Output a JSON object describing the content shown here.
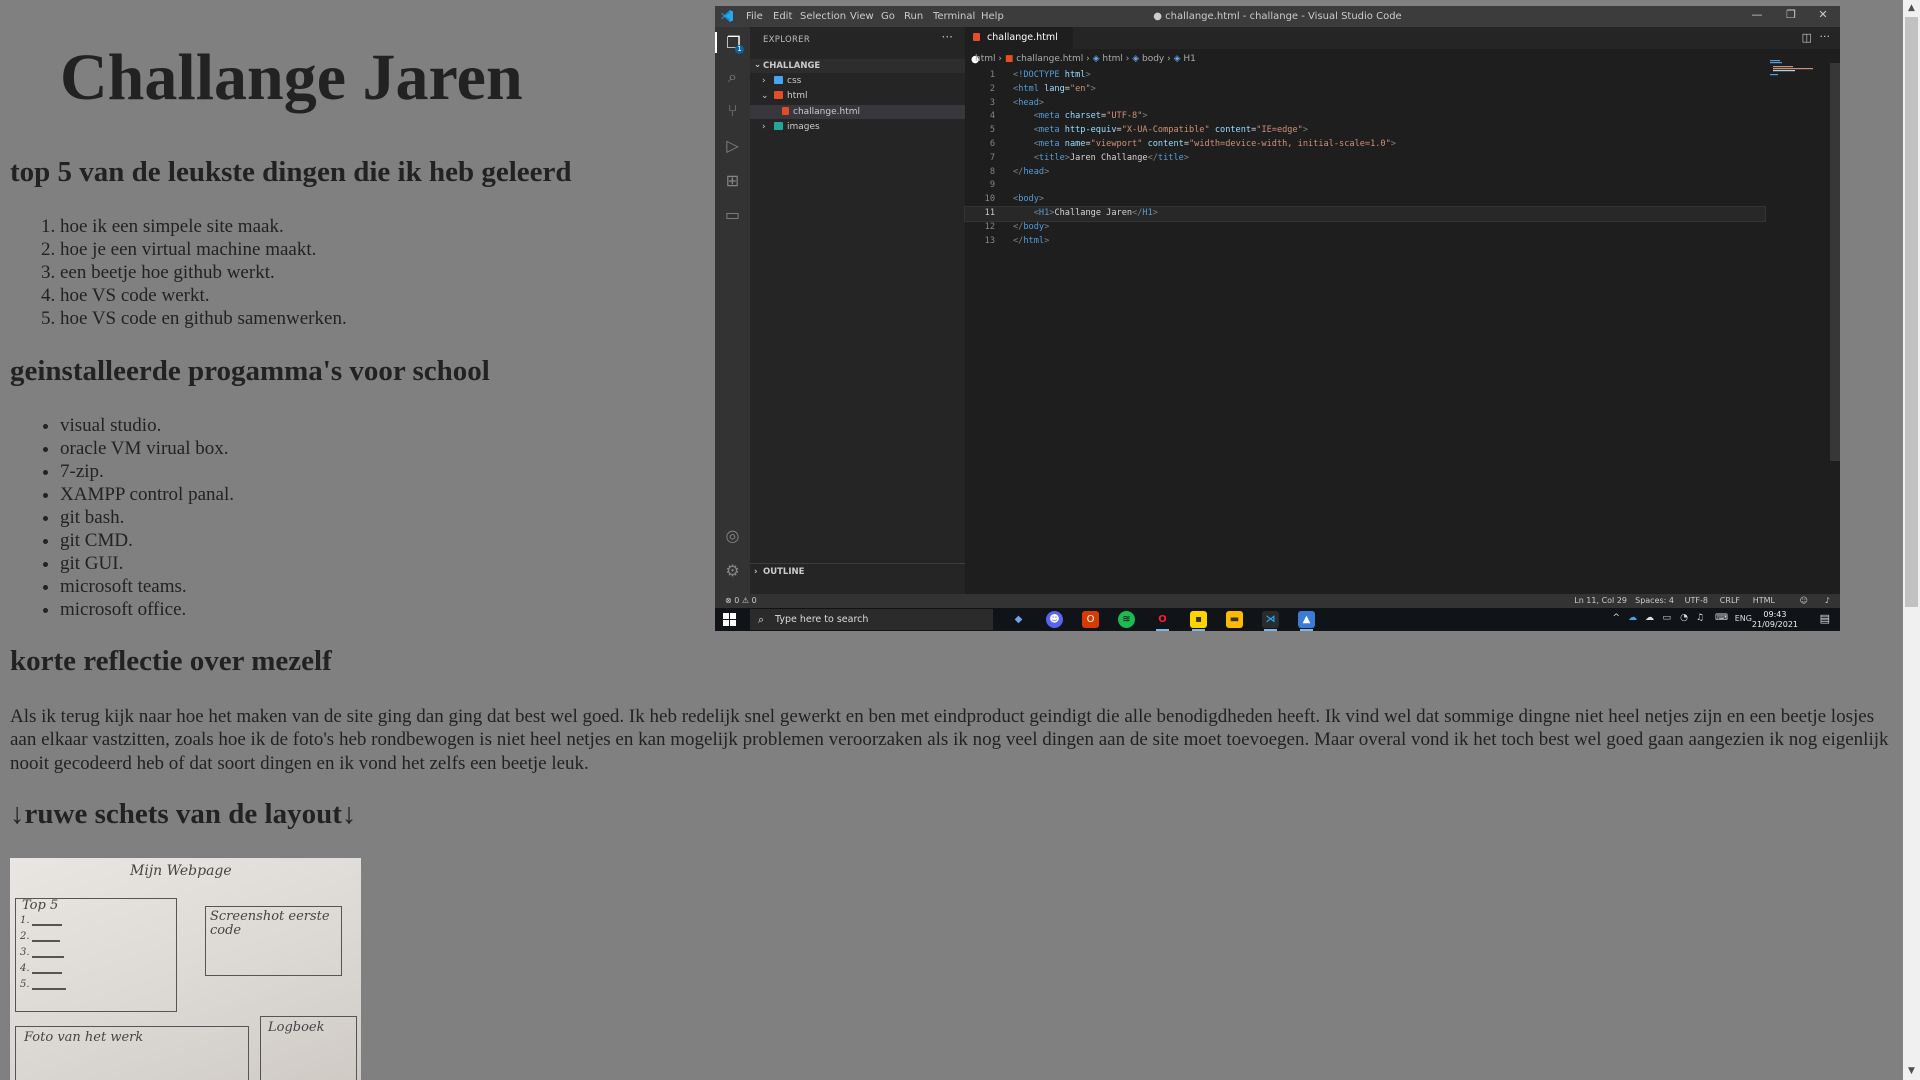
{
  "page": {
    "title": "Challange Jaren",
    "sections": [
      {
        "heading": "top 5 van de leukste dingen die ik heb geleerd",
        "items": [
          "hoe ik een simpele site maak.",
          "hoe je een virtual machine maakt.",
          "een beetje hoe github werkt.",
          "hoe VS code werkt.",
          "hoe VS code en github samenwerken."
        ]
      },
      {
        "heading": "geinstalleerde progamma's voor school",
        "items": [
          "visual studio.",
          "oracle VM virual box.",
          "7-zip.",
          "XAMPP control panal.",
          "git bash.",
          "git CMD.",
          "git GUI.",
          "microsoft teams.",
          "microsoft office."
        ]
      },
      {
        "heading": "korte reflectie over mezelf",
        "text": "Als ik terug kijk naar hoe het maken van de site ging dan ging dat best wel goed. Ik heb redelijk snel gewerkt en ben met eindproduct geindigt die alle benodigdheden heeft. Ik vind wel dat sommige dingne niet heel netjes zijn en een beetje losjes aan elkaar vastzitten, zoals hoe ik de foto's heb rondbewogen is niet heel netjes en kan mogelijk problemen veroorzaken als ik nog veel dingen aan de site moet toevoegen. Maar overal vond ik het toch best wel goed gaan aangezien ik nog eigenlijk nooit gecodeerd heb of dat soort dingen en ik vond het zelfs een beetje leuk."
      },
      {
        "heading": "↓ruwe schets van de layout↓"
      }
    ],
    "sketch": {
      "title": "Mijn Webpage",
      "box_top5": "Top 5",
      "box_list": [
        "1.",
        "2.",
        "3.",
        "4.",
        "5."
      ],
      "box_screenshot": "Screenshot eerste code",
      "box_foto": "Foto van het werk",
      "box_logboek": "Logboek"
    }
  },
  "scrollbar": {
    "up": "▲",
    "down": "▼"
  },
  "vscode": {
    "menu": [
      "File",
      "Edit",
      "Selection",
      "View",
      "Go",
      "Run",
      "Terminal",
      "Help"
    ],
    "window_title": "● challange.html - challange - Visual Studio Code",
    "window_buttons": {
      "minimize": "—",
      "restore": "❐",
      "close": "✕"
    },
    "explorer": {
      "header": "EXPLORER",
      "more": "···",
      "root": "CHALLANGE",
      "tree": [
        {
          "label": "css",
          "chevron": "›"
        },
        {
          "label": "html",
          "chevron": "⌄"
        },
        {
          "label": "challange.html",
          "chevron": ""
        },
        {
          "label": "images",
          "chevron": "›"
        }
      ],
      "outline": "OUTLINE"
    },
    "activity_badge": "1",
    "tab": {
      "label": "challange.html",
      "dirty": "●"
    },
    "breadcrumbs": [
      "html",
      "challange.html",
      "html",
      "body",
      "H1"
    ],
    "code_lines": [
      {
        "n": "1",
        "parts": [
          [
            "br",
            "<"
          ],
          [
            "tg",
            "!DOCTYPE"
          ],
          [
            "at",
            " html"
          ],
          [
            "br",
            ">"
          ]
        ]
      },
      {
        "n": "2",
        "parts": [
          [
            "br",
            "<"
          ],
          [
            "tg",
            "html"
          ],
          [
            "at",
            " lang"
          ],
          [
            "tx",
            "="
          ],
          [
            "st",
            "\"en\""
          ],
          [
            "br",
            ">"
          ]
        ]
      },
      {
        "n": "3",
        "parts": [
          [
            "br",
            "<"
          ],
          [
            "tg",
            "head"
          ],
          [
            "br",
            ">"
          ]
        ]
      },
      {
        "n": "4",
        "parts": [
          [
            "tx",
            "    "
          ],
          [
            "br",
            "<"
          ],
          [
            "tg",
            "meta"
          ],
          [
            "at",
            " charset"
          ],
          [
            "tx",
            "="
          ],
          [
            "st",
            "\"UTF-8\""
          ],
          [
            "br",
            ">"
          ]
        ]
      },
      {
        "n": "5",
        "parts": [
          [
            "tx",
            "    "
          ],
          [
            "br",
            "<"
          ],
          [
            "tg",
            "meta"
          ],
          [
            "at",
            " http-equiv"
          ],
          [
            "tx",
            "="
          ],
          [
            "st",
            "\"X-UA-Compatible\""
          ],
          [
            "at",
            " content"
          ],
          [
            "tx",
            "="
          ],
          [
            "st",
            "\"IE=edge\""
          ],
          [
            "br",
            ">"
          ]
        ]
      },
      {
        "n": "6",
        "parts": [
          [
            "tx",
            "    "
          ],
          [
            "br",
            "<"
          ],
          [
            "tg",
            "meta"
          ],
          [
            "at",
            " name"
          ],
          [
            "tx",
            "="
          ],
          [
            "st",
            "\"viewport\""
          ],
          [
            "at",
            " content"
          ],
          [
            "tx",
            "="
          ],
          [
            "st",
            "\"width=device-width, initial-scale=1.0\""
          ],
          [
            "br",
            ">"
          ]
        ]
      },
      {
        "n": "7",
        "parts": [
          [
            "tx",
            "    "
          ],
          [
            "br",
            "<"
          ],
          [
            "tg",
            "title"
          ],
          [
            "br",
            ">"
          ],
          [
            "tx",
            "Jaren Challange"
          ],
          [
            "br",
            "</"
          ],
          [
            "tg",
            "title"
          ],
          [
            "br",
            ">"
          ]
        ]
      },
      {
        "n": "8",
        "parts": [
          [
            "br",
            "</"
          ],
          [
            "tg",
            "head"
          ],
          [
            "br",
            ">"
          ]
        ]
      },
      {
        "n": "9",
        "parts": []
      },
      {
        "n": "10",
        "parts": [
          [
            "br",
            "<"
          ],
          [
            "tg",
            "body"
          ],
          [
            "br",
            ">"
          ]
        ]
      },
      {
        "n": "11",
        "parts": [
          [
            "tx",
            "    "
          ],
          [
            "br",
            "<"
          ],
          [
            "tg",
            "H1"
          ],
          [
            "br",
            ">"
          ],
          [
            "tx",
            "Challange Jaren"
          ],
          [
            "br",
            "</"
          ],
          [
            "tg",
            "H1"
          ],
          [
            "br",
            ">"
          ]
        ]
      },
      {
        "n": "12",
        "parts": [
          [
            "br",
            "</"
          ],
          [
            "tg",
            "body"
          ],
          [
            "br",
            ">"
          ]
        ]
      },
      {
        "n": "13",
        "parts": [
          [
            "br",
            "</"
          ],
          [
            "tg",
            "html"
          ],
          [
            "br",
            ">"
          ]
        ]
      }
    ],
    "status": {
      "problems": "⊗ 0 ⚠ 0",
      "position": "Ln 11, Col 29",
      "spaces": "Spaces: 4",
      "encoding": "UTF-8",
      "eol": "CRLF",
      "language": "HTML"
    },
    "taskbar": {
      "search_placeholder": "Type here to search",
      "lang": "ENG",
      "time": "09:43",
      "date": "21/09/2021"
    }
  }
}
